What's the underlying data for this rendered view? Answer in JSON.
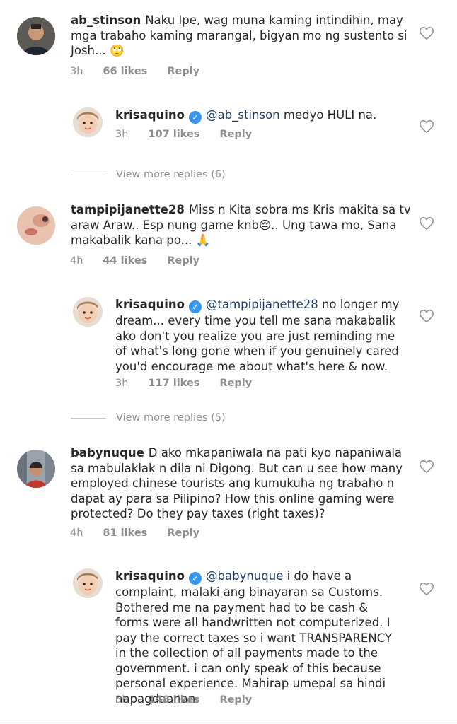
{
  "comments": [
    {
      "username": "ab_stinson",
      "text": "Naku Ipe, wag muna kaming intindihin, may mga trabaho kaming marangal, bigyan mo ng sustento si Josh... 🙄",
      "time": "3h",
      "likes": "66 likes",
      "reply": "Reply"
    },
    {
      "username": "krisaquino",
      "mention": "@ab_stinson",
      "text": " medyo HULI na.",
      "time": "3h",
      "likes": "107 likes",
      "reply": "Reply"
    },
    {
      "username": "tampipijanette28",
      "text": "Miss n Kita sobra ms Kris makita sa tv araw Araw.. Esp nung game knb😔.. Ung tawa mo, Sana makabalik kana po... 🙏",
      "time": "4h",
      "likes": "44 likes",
      "reply": "Reply"
    },
    {
      "username": "krisaquino",
      "mention": "@tampipijanette28",
      "text": " no longer my dream... every time you tell me sana makabalik ako don't you realize you are just reminding me of what's long gone when if you genuinely cared you'd encourage me about what's here & now.",
      "time": "3h",
      "likes": "117 likes",
      "reply": "Reply"
    },
    {
      "username": "babynuque",
      "text": "D ako mkapaniwala na pati kyo napaniwala sa mabulaklak n dila ni Digong. But can u see how many employed chinese tourists ang kumukuha ng trabaho n dapat ay para sa Pilipino? How this online gaming were protected? Do they pay taxes (right taxes)?",
      "time": "4h",
      "likes": "81 likes",
      "reply": "Reply"
    },
    {
      "username": "krisaquino",
      "mention": "@babynuque",
      "text": " i do have a complaint, malaki ang binayaran sa Customs. Bothered me na payment had to be cash & forms were all handwritten not computerized. I pay the correct taxes so i want TRANSPARENCY in the collection of all payments made to the government. i can only speak of this because personal experience. Mahirap umepal sa hindi napagdaanan.",
      "time": "3h",
      "likes": "148 likes",
      "reply": "Reply"
    }
  ],
  "view_more": [
    {
      "label": "View more replies (6)"
    },
    {
      "label": "View more replies (5)"
    }
  ],
  "icons": {
    "verified": "verified-badge-icon",
    "heart": "heart-outline-icon"
  },
  "colors": {
    "accent": "#3897f0",
    "meta": "#8e8e8e",
    "mention": "#1d3d6a"
  }
}
